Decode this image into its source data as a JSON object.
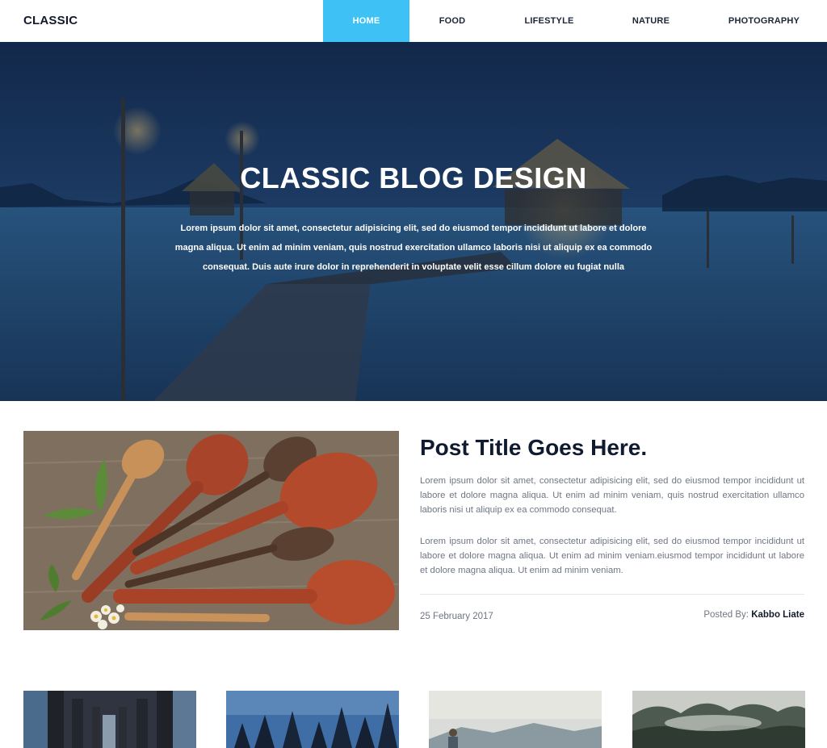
{
  "header": {
    "logo": "CLASSIC",
    "nav": [
      {
        "label": "HOME",
        "active": true
      },
      {
        "label": "FOOD",
        "active": false
      },
      {
        "label": "LIFESTYLE",
        "active": false
      },
      {
        "label": "NATURE",
        "active": false
      },
      {
        "label": "PHOTOGRAPHY",
        "active": false
      }
    ]
  },
  "hero": {
    "title": "CLASSIC BLOG DESIGN",
    "text": "Lorem ipsum dolor sit amet, consectetur adipisicing elit, sed do eiusmod tempor incididunt ut labore et dolore magna aliqua. Ut enim ad minim veniam, quis nostrud exercitation ullamco laboris nisi ut aliquip ex ea commodo consequat. Duis aute irure dolor in reprehenderit in voluptate velit esse cillum dolore eu fugiat nulla"
  },
  "post": {
    "title": "Post Title Goes Here.",
    "paragraph1": "Lorem ipsum dolor sit amet, consectetur adipisicing elit, sed do eiusmod tempor incididunt ut labore et dolore magna aliqua. Ut enim ad minim veniam, quis nostrud exercitation ullamco laboris nisi ut aliquip ex ea commodo consequat.",
    "paragraph2": "Lorem ipsum dolor sit amet, consectetur adipisicing elit, sed do eiusmod tempor incididunt ut labore et dolore magna aliqua. Ut enim ad minim veniam.eiusmod tempor incididunt ut labore et dolore magna aliqua. Ut enim ad minim veniam.",
    "date": "25 February 2017",
    "posted_by_label": "Posted By:",
    "author": "Kabbo Liate"
  },
  "colors": {
    "accent": "#3ec1f5",
    "hero_overlay": "#1a3458",
    "heading": "#101a30",
    "body_text": "#6f7683"
  }
}
